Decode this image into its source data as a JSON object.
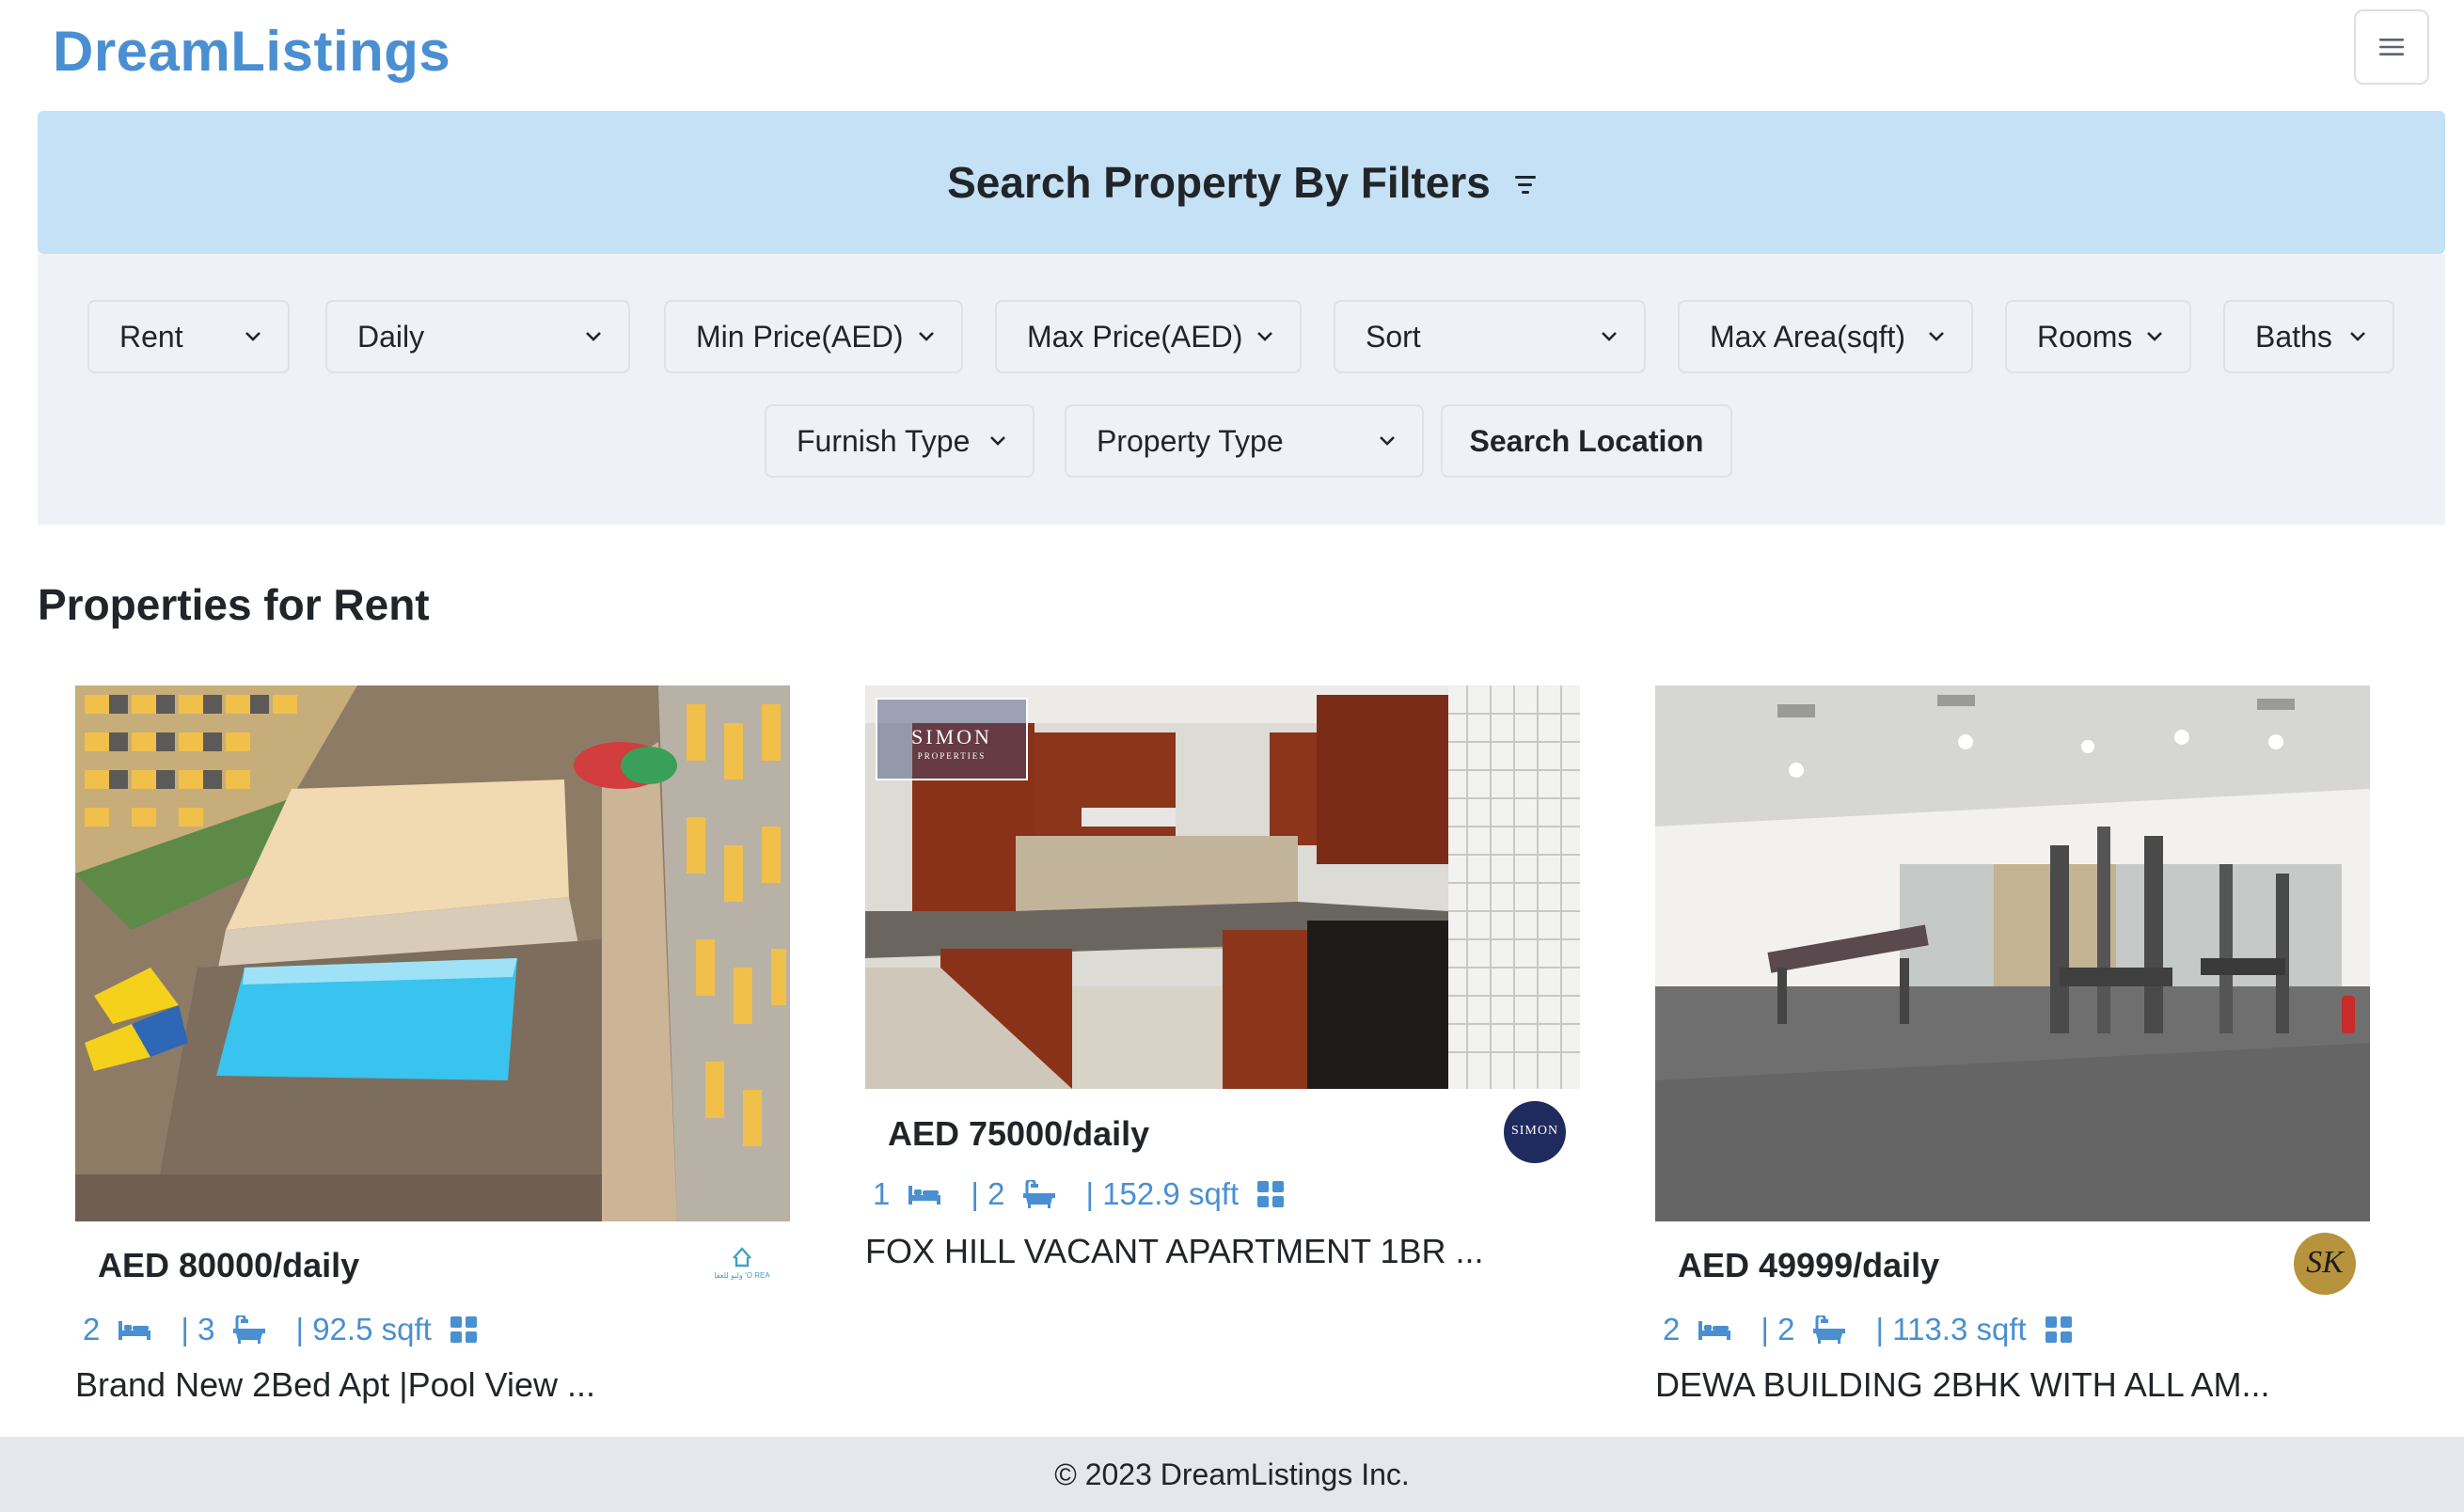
{
  "brand": "DreamListings",
  "filters": {
    "title": "Search Property By Filters",
    "row1": [
      "Rent",
      "Daily",
      "Min Price(AED)",
      "Max Price(AED)",
      "Sort",
      "Max Area(sqft)",
      "Rooms",
      "Baths"
    ],
    "row2": [
      "Furnish Type",
      "Property Type"
    ],
    "search_location": "Search Location"
  },
  "section_title": "Properties for Rent",
  "listings": [
    {
      "price": "AED 80000/daily",
      "rooms": "2",
      "baths": "| 3",
      "area": "| 92.5 sqft",
      "title": "Brand New 2Bed Apt |Pool View ...",
      "agency_logo_text": "وليو للعقا ’O REA"
    },
    {
      "price": "AED 75000/daily",
      "rooms": "1",
      "baths": "| 2",
      "area": "| 152.9 sqft",
      "title": "FOX HILL VACANT APARTMENT 1BR ...",
      "watermark": "SIMON",
      "watermark_sub": "PROPERTIES",
      "agency_logo_text": "SIMON"
    },
    {
      "price": "AED 49999/daily",
      "rooms": "2",
      "baths": "| 2",
      "area": "| 113.3 sqft",
      "title": "DEWA BUILDING 2BHK WITH ALL AM...",
      "agency_logo_text": "SK"
    }
  ],
  "footer": "© 2023 DreamListings Inc.",
  "colors": {
    "brand": "#4a8fd1",
    "banner": "#c5e1f5",
    "panel": "#eef1f6",
    "footer": "#e4e7ee"
  }
}
